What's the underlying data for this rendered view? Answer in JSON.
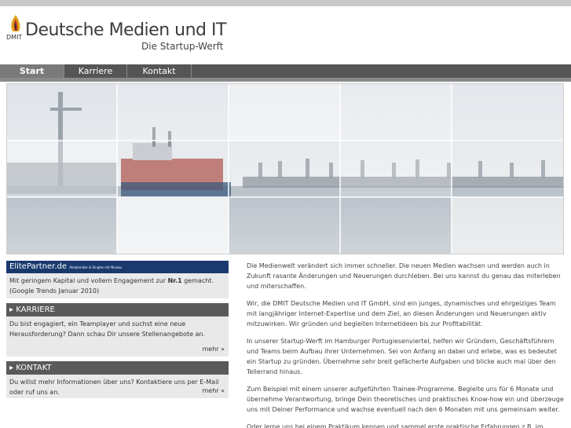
{
  "header": {
    "logo_mark": "DMIT",
    "brand": "Deutsche Medien und IT",
    "tagline": "Die Startup-Werft"
  },
  "nav": {
    "items": [
      {
        "label": "Start",
        "active": true
      },
      {
        "label": "Karriere",
        "active": false
      },
      {
        "label": "Kontakt",
        "active": false
      }
    ]
  },
  "sidebar": {
    "elitepartner": {
      "logo": "ElitePartner.de",
      "logo_sub": "Akademiker & Singles mit Niveau",
      "text_before": "Mit geringem Kapital und vollem Engagement zur ",
      "text_bold": "Nr.1",
      "text_after": " gemacht. (Google Trends Januar 2010)"
    },
    "karriere": {
      "heading": "KARRIERE",
      "text": "Du bist engagiert, ein Teamplayer und suchst eine neue Herausforderung? Dann schau Dir unsere Stellenangebote an.",
      "more": "mehr »"
    },
    "kontakt": {
      "heading": "KONTAKT",
      "text": "Du willst mehr Informationen über uns? Kontaktiere uns per E-Mail oder ruf uns an.",
      "more": "mehr »"
    }
  },
  "main": {
    "paragraphs": [
      "Die Medienwelt verändert sich immer schneller. Die neuen Medien wachsen und werden auch in Zukunft rasante Änderungen und Neuerungen durchleben. Bei uns kannst du genau das miterleben und miterschaffen.",
      "Wir, die DMIT Deutsche Medien und IT GmbH, sind ein junges, dynamisches und ehrgeiziges Team mit langjähriger Internet-Expertise und dem Ziel, an diesen Änderungen und Neuerungen aktiv mitzuwirken. Wir gründen und begleiten Internetideen bis zur Profitabilität.",
      "In unserer Startup-Werft im Hamburger Portugiesenviertel, helfen wir Gründern, Geschäftsführern und Teams beim Aufbau ihrer Unternehmen. Sei von Anfang an dabei und erlebe, was es bedeutet ein Startup zu gründen. Übernehme sehr breit gefächerte Aufgaben und blicke auch mal über den Tellerrand hinaus.",
      "Zum Beispiel mit einem unserer aufgeführten Trainee-Programme. Begleite uns für 6 Monate und übernehme Verantwortung, bringe Dein theoretisches und praktisches Know-how ein und überzeuge uns mit Deiner Performance und wachse eventuell nach den 6 Monaten mit uns gemeinsam weiter.",
      "Oder lerne uns bei einem Praktikum kennen und sammel erste praktische Erfahrungen z.B. im Online-"
    ]
  },
  "colors": {
    "nav_bg": "#555555",
    "nav_active": "#7a7a7a",
    "elitepartner_blue": "#1a3a6e",
    "box_head": "#5a5a5a",
    "box_body": "#e9e9e9"
  },
  "icons": {
    "logo": "flame-logo-icon",
    "box_bullet": "triangle-right-icon"
  }
}
